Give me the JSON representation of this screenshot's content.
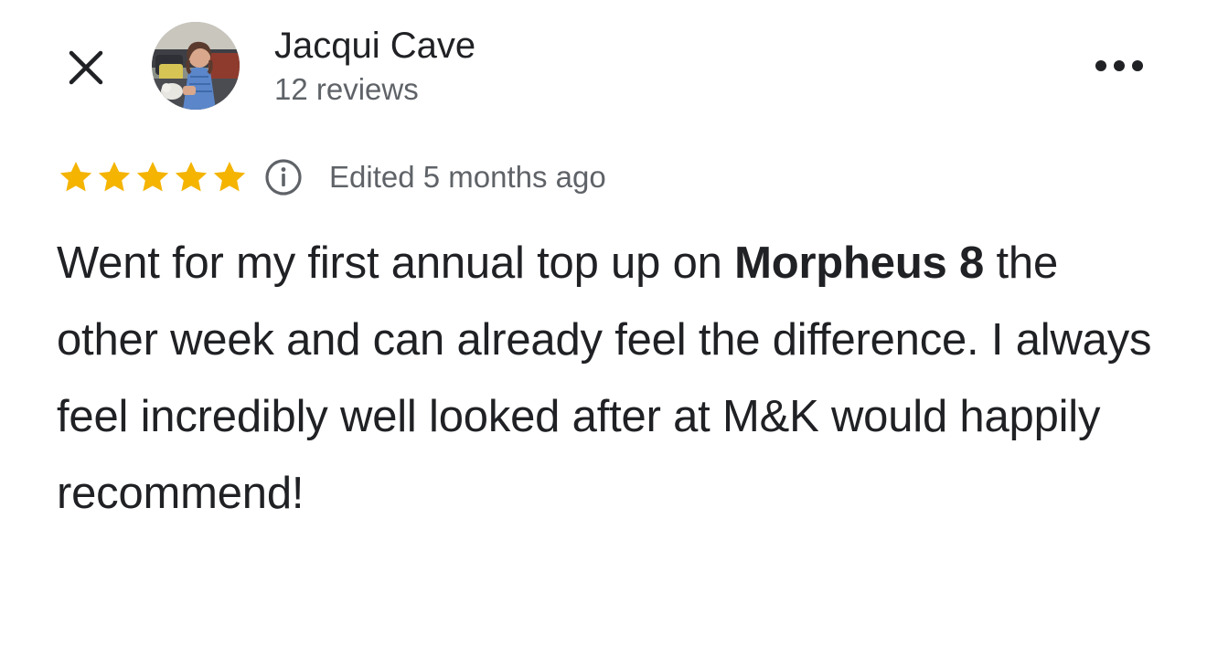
{
  "header": {
    "close_icon": "close-icon",
    "more_icon": "more-horizontal-icon",
    "avatar_icon": "avatar-photo"
  },
  "reviewer": {
    "name": "Jacqui Cave",
    "review_count": "12 reviews"
  },
  "rating": {
    "stars": 5,
    "max_stars": 5,
    "star_color": "#f4b400",
    "info_icon": "info-icon",
    "edited": "Edited 5 months ago"
  },
  "review": {
    "text_before": "Went for my first annual top up on ",
    "highlight": "Morpheus 8",
    "text_after": " the other week and can already feel the difference. I always feel incredibly well looked after at M&K would happily recommend!"
  },
  "colors": {
    "primary_text": "#202124",
    "secondary_text": "#5f6368",
    "background": "#ffffff"
  }
}
